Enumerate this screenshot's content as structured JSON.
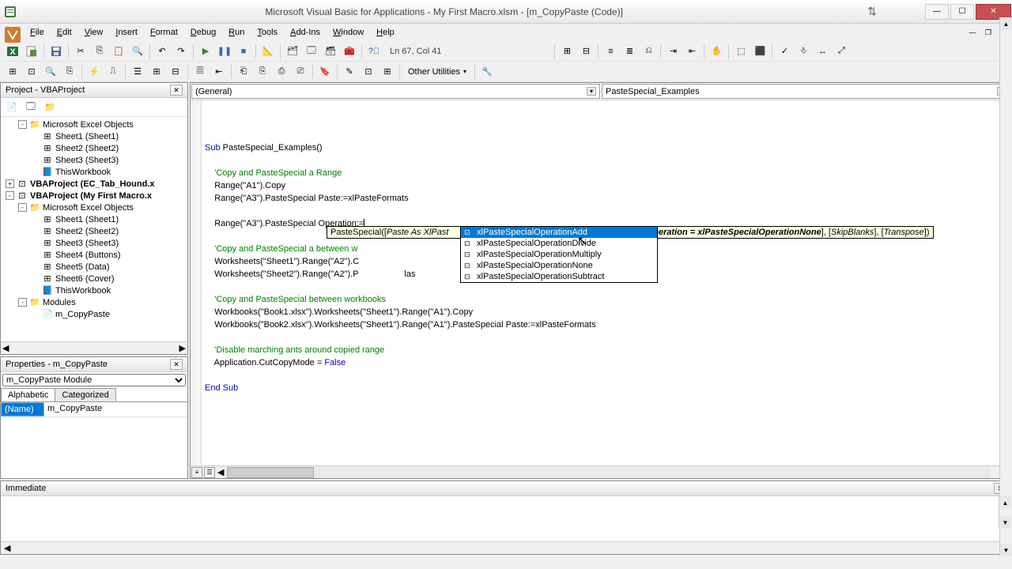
{
  "titlebar": {
    "title": "Microsoft Visual Basic for Applications - My First Macro.xlsm - [m_CopyPaste (Code)]"
  },
  "menus": [
    "File",
    "Edit",
    "View",
    "Insert",
    "Format",
    "Debug",
    "Run",
    "Tools",
    "Add-Ins",
    "Window",
    "Help"
  ],
  "status": "Ln 67, Col 41",
  "other_utilities": "Other Utilities",
  "project": {
    "title": "Project - VBAProject",
    "tree": [
      {
        "indent": 1,
        "toggle": "-",
        "icon": "folder",
        "label": "Microsoft Excel Objects"
      },
      {
        "indent": 2,
        "icon": "sheet",
        "label": "Sheet1 (Sheet1)"
      },
      {
        "indent": 2,
        "icon": "sheet",
        "label": "Sheet2 (Sheet2)"
      },
      {
        "indent": 2,
        "icon": "sheet",
        "label": "Sheet3 (Sheet3)"
      },
      {
        "indent": 2,
        "icon": "wb",
        "label": "ThisWorkbook"
      },
      {
        "indent": 0,
        "toggle": "+",
        "icon": "proj",
        "label": "VBAProject (EC_Tab_Hound.x",
        "bold": true
      },
      {
        "indent": 0,
        "toggle": "-",
        "icon": "proj",
        "label": "VBAProject (My First Macro.x",
        "bold": true
      },
      {
        "indent": 1,
        "toggle": "-",
        "icon": "folder",
        "label": "Microsoft Excel Objects"
      },
      {
        "indent": 2,
        "icon": "sheet",
        "label": "Sheet1 (Sheet1)"
      },
      {
        "indent": 2,
        "icon": "sheet",
        "label": "Sheet2 (Sheet2)"
      },
      {
        "indent": 2,
        "icon": "sheet",
        "label": "Sheet3 (Sheet3)"
      },
      {
        "indent": 2,
        "icon": "sheet",
        "label": "Sheet4 (Buttons)"
      },
      {
        "indent": 2,
        "icon": "sheet",
        "label": "Sheet5 (Data)"
      },
      {
        "indent": 2,
        "icon": "sheet",
        "label": "Sheet6 (Cover)"
      },
      {
        "indent": 2,
        "icon": "wb",
        "label": "ThisWorkbook"
      },
      {
        "indent": 1,
        "toggle": "-",
        "icon": "folder",
        "label": "Modules"
      },
      {
        "indent": 2,
        "icon": "mod",
        "label": "m_CopyPaste"
      }
    ]
  },
  "properties": {
    "title": "Properties - m_CopyPaste",
    "object": "m_CopyPaste Module",
    "tabs": [
      "Alphabetic",
      "Categorized"
    ],
    "rows": [
      {
        "name": "(Name)",
        "value": "m_CopyPaste"
      }
    ]
  },
  "code": {
    "left_dd": "(General)",
    "right_dd": "PasteSpecial_Examples",
    "lines": [
      {
        "t": "kw",
        "text": "Sub PasteSpecial_Examples()"
      },
      {
        "t": "",
        "text": ""
      },
      {
        "t": "cm",
        "text": "    'Copy and PasteSpecial a Range"
      },
      {
        "t": "",
        "text": "    Range(\"A1\").Copy"
      },
      {
        "t": "",
        "text": "    Range(\"A3\").PasteSpecial Paste:=xlPasteFormats"
      },
      {
        "t": "",
        "text": ""
      },
      {
        "t": "cur",
        "text": "    Range(\"A3\").PasteSpecial Operation:="
      },
      {
        "t": "",
        "text": ""
      },
      {
        "t": "cm",
        "text": "    'Copy and PasteSpecial a between w"
      },
      {
        "t": "",
        "text": "    Worksheets(\"Sheet1\").Range(\"A2\").C"
      },
      {
        "t": "",
        "text": "    Worksheets(\"Sheet2\").Range(\"A2\").P                   las"
      },
      {
        "t": "",
        "text": ""
      },
      {
        "t": "cm",
        "text": "    'Copy and PasteSpecial between workbooks"
      },
      {
        "t": "",
        "text": "    Workbooks(\"Book1.xlsx\").Worksheets(\"Sheet1\").Range(\"A1\").Copy"
      },
      {
        "t": "",
        "text": "    Workbooks(\"Book2.xlsx\").Worksheets(\"Sheet1\").Range(\"A1\").PasteSpecial Paste:=xlPasteFormats"
      },
      {
        "t": "",
        "text": ""
      },
      {
        "t": "cm",
        "text": "    'Disable marching ants around copied range"
      },
      {
        "t": "",
        "text": "    Application.CutCopyMode = False"
      },
      {
        "t": "",
        "text": ""
      },
      {
        "t": "kw",
        "text": "End Sub"
      }
    ]
  },
  "tooltip": {
    "prefix": "PasteSpecial([",
    "arg1": "Paste As XlPast",
    "mid": "cialOperation = xlPasteSpecialOperationNone",
    "arg3": "SkipBlanks",
    "arg4": "Transpose"
  },
  "intellisense": {
    "items": [
      {
        "label": "xlPasteSpecialOperationAdd",
        "selected": true
      },
      {
        "label": "xlPasteSpecialOperationDivide"
      },
      {
        "label": "xlPasteSpecialOperationMultiply"
      },
      {
        "label": "xlPasteSpecialOperationNone"
      },
      {
        "label": "xlPasteSpecialOperationSubtract"
      }
    ]
  },
  "immediate": {
    "title": "Immediate"
  }
}
